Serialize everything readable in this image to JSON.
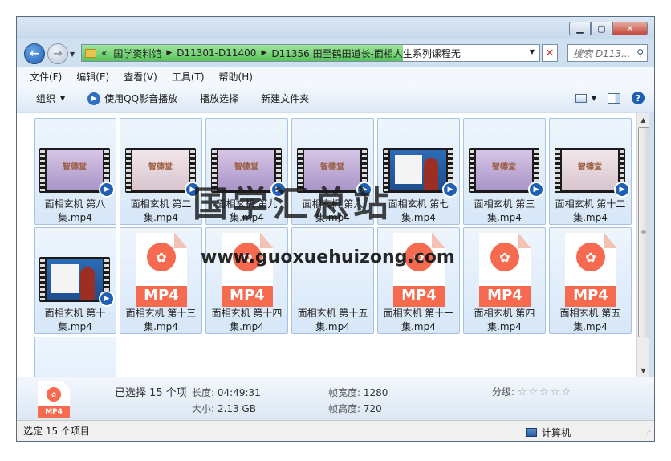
{
  "address": {
    "crumbs": [
      "国学资料馆",
      "D11301-D11400",
      "D11356 田至鹤田道长-面相人生系列课程无"
    ],
    "lead": "«"
  },
  "search": {
    "placeholder": "搜索 D113..."
  },
  "menu": [
    "文件(F)",
    "编辑(E)",
    "查看(V)",
    "工具(T)",
    "帮助(H)"
  ],
  "toolbar": {
    "organize": "组织",
    "play_qq": "使用QQ影音播放",
    "playlist": "播放选择",
    "new_folder": "新建文件夹"
  },
  "files": [
    {
      "name": "面相玄机 第八集.mp4",
      "thumb": "video",
      "scene": "purple"
    },
    {
      "name": "面相玄机 第二集.mp4",
      "thumb": "video",
      "scene": "pink"
    },
    {
      "name": "面相玄机 第九集.mp4",
      "thumb": "video",
      "scene": "purple"
    },
    {
      "name": "面相玄机 第六集.mp4",
      "thumb": "video",
      "scene": "purple"
    },
    {
      "name": "面相玄机 第七集.mp4",
      "thumb": "video",
      "scene": "board"
    },
    {
      "name": "面相玄机 第三集.mp4",
      "thumb": "video",
      "scene": "purple"
    },
    {
      "name": "面相玄机 第十二集.mp4",
      "thumb": "video",
      "scene": "pink"
    },
    {
      "name": "面相玄机 第十集.mp4",
      "thumb": "video",
      "scene": "board"
    },
    {
      "name": "面相玄机 第十三集.mp4",
      "thumb": "mp4"
    },
    {
      "name": "面相玄机 第十四集.mp4",
      "thumb": "mp4"
    },
    {
      "name": "面相玄机 第十五集.mp4",
      "thumb": "none"
    },
    {
      "name": "面相玄机 第十一集.mp4",
      "thumb": "mp4"
    },
    {
      "name": "面相玄机 第四集.mp4",
      "thumb": "mp4"
    },
    {
      "name": "面相玄机 第五集.mp4",
      "thumb": "mp4"
    },
    {
      "name": "",
      "thumb": "none"
    }
  ],
  "thumb_text": {
    "logo": "智德堂",
    "mp4": "MP4"
  },
  "details": {
    "selected": "已选择 15 个项",
    "length_label": "长度:",
    "length": "04:49:31",
    "size_label": "大小:",
    "size": "2.13 GB",
    "width_label": "帧宽度:",
    "width": "1280",
    "height_label": "帧高度:",
    "height": "720",
    "rating_label": "分级:",
    "rating_stars": "☆☆☆☆☆",
    "icon_label": "MP4"
  },
  "status": {
    "left": "选定 15 个项目",
    "right": "计算机"
  },
  "watermark": {
    "title": "国学汇总站",
    "url": "www.guoxuehuizong.com"
  }
}
